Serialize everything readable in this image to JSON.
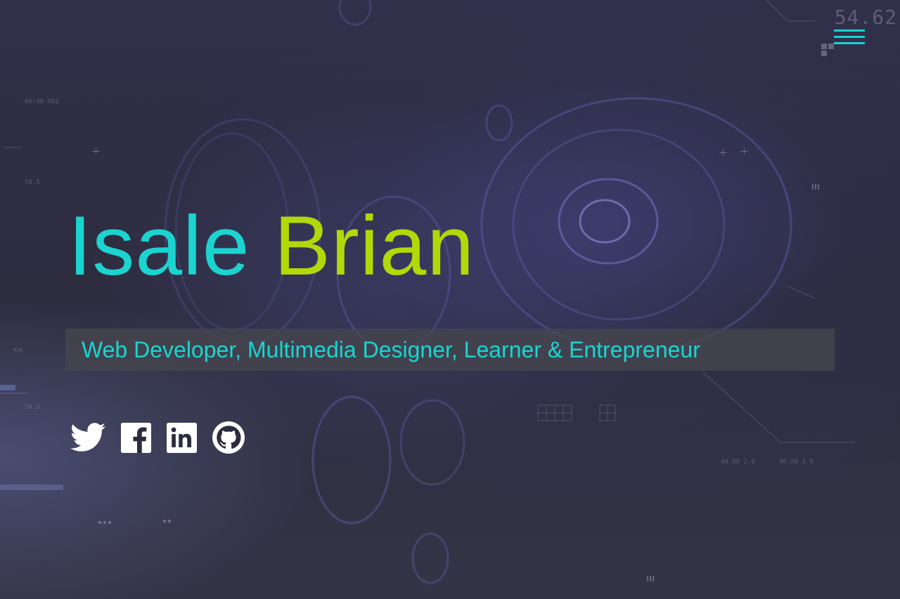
{
  "header": {
    "hud_readout": "54.62",
    "menu_icon": "hamburger-icon"
  },
  "hero": {
    "first_name": "Isale",
    "last_name": "Brian",
    "tagline": "Web Developer, Multimedia Designer, Learner & Entrepreneur"
  },
  "social": [
    {
      "icon": "twitter-icon"
    },
    {
      "icon": "facebook-icon"
    },
    {
      "icon": "linkedin-icon"
    },
    {
      "icon": "github-icon"
    }
  ],
  "colors": {
    "accent_cyan": "#1bd4cf",
    "accent_lime": "#b2d80a",
    "background": "#2d2c3e"
  }
}
